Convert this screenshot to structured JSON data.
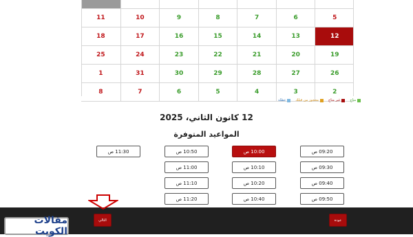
{
  "calendar": {
    "rows": [
      [
        {
          "t": "",
          "c": ""
        },
        {
          "t": "",
          "c": ""
        },
        {
          "t": "",
          "c": ""
        },
        {
          "t": "",
          "c": ""
        },
        {
          "t": "",
          "c": ""
        },
        {
          "t": "",
          "c": ""
        },
        {
          "t": "",
          "c": "greyed"
        }
      ],
      [
        {
          "t": "5",
          "c": "red"
        },
        {
          "t": "6",
          "c": "green"
        },
        {
          "t": "7",
          "c": "green"
        },
        {
          "t": "8",
          "c": "green"
        },
        {
          "t": "9",
          "c": "green"
        },
        {
          "t": "10",
          "c": "red"
        },
        {
          "t": "11",
          "c": "red"
        }
      ],
      [
        {
          "t": "12",
          "c": "selected"
        },
        {
          "t": "13",
          "c": "green"
        },
        {
          "t": "14",
          "c": "green"
        },
        {
          "t": "15",
          "c": "green"
        },
        {
          "t": "16",
          "c": "green"
        },
        {
          "t": "17",
          "c": "red"
        },
        {
          "t": "18",
          "c": "red"
        }
      ],
      [
        {
          "t": "19",
          "c": "green"
        },
        {
          "t": "20",
          "c": "green"
        },
        {
          "t": "21",
          "c": "green"
        },
        {
          "t": "22",
          "c": "green"
        },
        {
          "t": "23",
          "c": "green"
        },
        {
          "t": "24",
          "c": "red"
        },
        {
          "t": "25",
          "c": "red"
        }
      ],
      [
        {
          "t": "26",
          "c": "green"
        },
        {
          "t": "27",
          "c": "green"
        },
        {
          "t": "28",
          "c": "green"
        },
        {
          "t": "29",
          "c": "green"
        },
        {
          "t": "30",
          "c": "green"
        },
        {
          "t": "31",
          "c": "red"
        },
        {
          "t": "1",
          "c": "red"
        }
      ],
      [
        {
          "t": "2",
          "c": "green"
        },
        {
          "t": "3",
          "c": "green"
        },
        {
          "t": "4",
          "c": "green"
        },
        {
          "t": "5",
          "c": "green"
        },
        {
          "t": "6",
          "c": "green"
        },
        {
          "t": "7",
          "c": "red"
        },
        {
          "t": "8",
          "c": "red"
        }
      ]
    ]
  },
  "legend": [
    {
      "label": "متاح",
      "color": "#6abf4b"
    },
    {
      "label": "غير متاح",
      "color": "#a80c0c"
    },
    {
      "label": "محجوز من قبلك",
      "color": "#e0a020"
    },
    {
      "label": "عطلة",
      "color": "#7fb8e0"
    }
  ],
  "selected_date": "12 كانون الثاني، 2025",
  "slots_heading": "المواعيد المتوفرة",
  "slots": [
    {
      "label": "09:20 ص",
      "active": false
    },
    {
      "label": "09:30 ص",
      "active": false
    },
    {
      "label": "09:40 ص",
      "active": false
    },
    {
      "label": "09:50 ص",
      "active": false
    },
    {
      "label": "10:00 ص",
      "active": true
    },
    {
      "label": "10:10 ص",
      "active": false
    },
    {
      "label": "10:20 ص",
      "active": false
    },
    {
      "label": "10:40 ص",
      "active": false
    },
    {
      "label": "10:50 ص",
      "active": false
    },
    {
      "label": "11:00 ص",
      "active": false
    },
    {
      "label": "11:10 ص",
      "active": false
    },
    {
      "label": "11:20 ص",
      "active": false
    },
    {
      "label": "11:30 ص",
      "active": false
    }
  ],
  "buttons": {
    "back": "عودة",
    "next": "التالي"
  },
  "watermark": "مقالات الكويت"
}
